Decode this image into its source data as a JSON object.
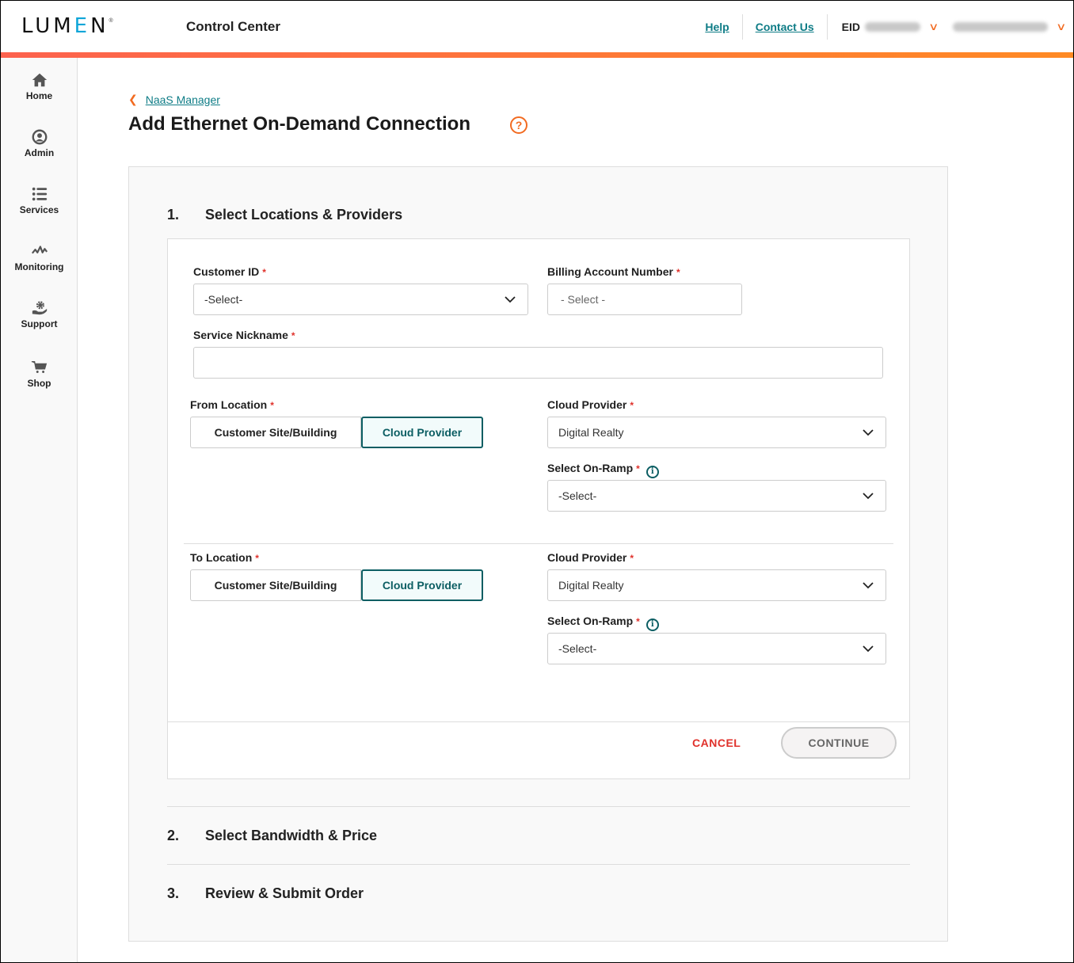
{
  "header": {
    "logo": "LUMEN",
    "logo_mark": "®",
    "app_title": "Control Center",
    "links": [
      "Help",
      "Contact Us"
    ],
    "eid_label": "EID",
    "colors": {
      "link": "#0e7c86",
      "accent": "#f26b21",
      "stripe_start": "#fd624e",
      "stripe_end": "#ff8a24"
    }
  },
  "sidebar": {
    "items": [
      {
        "label": "Home",
        "icon": "home-icon"
      },
      {
        "label": "Admin",
        "icon": "user-circle-icon"
      },
      {
        "label": "Services",
        "icon": "list-icon"
      },
      {
        "label": "Monitoring",
        "icon": "pulse-icon"
      },
      {
        "label": "Support",
        "icon": "support-gear-hand-icon"
      },
      {
        "label": "Shop",
        "icon": "cart-icon"
      }
    ]
  },
  "breadcrumb": {
    "back_label": "NaaS Manager"
  },
  "page": {
    "title": "Add Ethernet On-Demand Connection",
    "help_icon": "?"
  },
  "steps": [
    {
      "num": "1.",
      "title": "Select Locations & Providers"
    },
    {
      "num": "2.",
      "title": "Select Bandwidth & Price"
    },
    {
      "num": "3.",
      "title": "Review & Submit Order"
    }
  ],
  "form": {
    "required_mark": "*",
    "customer_id": {
      "label": "Customer ID",
      "value": "-Select-"
    },
    "billing_account": {
      "label": "Billing Account Number",
      "value": "- Select -"
    },
    "service_nickname": {
      "label": "Service Nickname",
      "value": "",
      "placeholder": ""
    },
    "from_location": {
      "label": "From Location",
      "options": [
        "Customer Site/Building",
        "Cloud Provider"
      ],
      "selected": "Cloud Provider",
      "cloud_provider": {
        "label": "Cloud Provider",
        "value": "Digital Realty"
      },
      "on_ramp": {
        "label": "Select On-Ramp",
        "value": "-Select-",
        "info_icon": "i"
      }
    },
    "to_location": {
      "label": "To Location",
      "options": [
        "Customer Site/Building",
        "Cloud Provider"
      ],
      "selected": "Cloud Provider",
      "cloud_provider": {
        "label": "Cloud Provider",
        "value": "Digital Realty"
      },
      "on_ramp": {
        "label": "Select On-Ramp",
        "value": "-Select-",
        "info_icon": "i"
      }
    },
    "cancel_label": "CANCEL",
    "continue_label": "CONTINUE"
  }
}
